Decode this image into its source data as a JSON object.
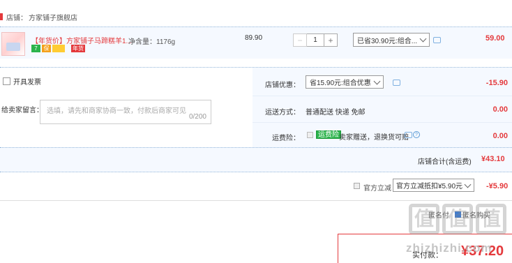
{
  "shop": {
    "label": "店铺：",
    "name": "方家铺子旗舰店"
  },
  "item": {
    "title": "【年货价】方家铺子马蹄糕羊1...",
    "badges": [
      "7",
      "保",
      "",
      "年货"
    ],
    "weight": "净含量：1176g",
    "unit_price": "89.90",
    "quantity": "1",
    "qty_minus": "−",
    "qty_plus": "+",
    "promo": "已省30.90元:组合...",
    "subtotal": "59.00"
  },
  "options": {
    "invoice_label": "开具发票",
    "message_label": "给卖家留言：",
    "message_placeholder": "选填，请先和商家协商一致，付款后商家可见",
    "message_count": "0/200"
  },
  "store_promo": {
    "label": "店铺优惠：",
    "selected": "省15.90元:组合优惠",
    "amount": "-15.90"
  },
  "shipping": {
    "label": "运送方式：",
    "method": "普通配送 快递 免邮",
    "amount": "0.00"
  },
  "insurance": {
    "label": "运费险：",
    "tag": "运费险",
    "text": "卖家赠送，退换货可赔",
    "amount": "0.00",
    "help": "?"
  },
  "store_total": {
    "label": "店铺合计(含运费)",
    "amount": "¥43.10"
  },
  "coupon": {
    "label": "官方立减",
    "selected": "官方立减抵扣¥5.90元",
    "amount": "-¥5.90"
  },
  "anonymous": {
    "prefix": "匿名付",
    "label": "匿名购买"
  },
  "payment": {
    "label": "实付款：",
    "amount": "¥37.20"
  },
  "watermark": {
    "logo_chars": [
      "值",
      "值",
      "值"
    ],
    "text": "zhizhizhi.com"
  }
}
